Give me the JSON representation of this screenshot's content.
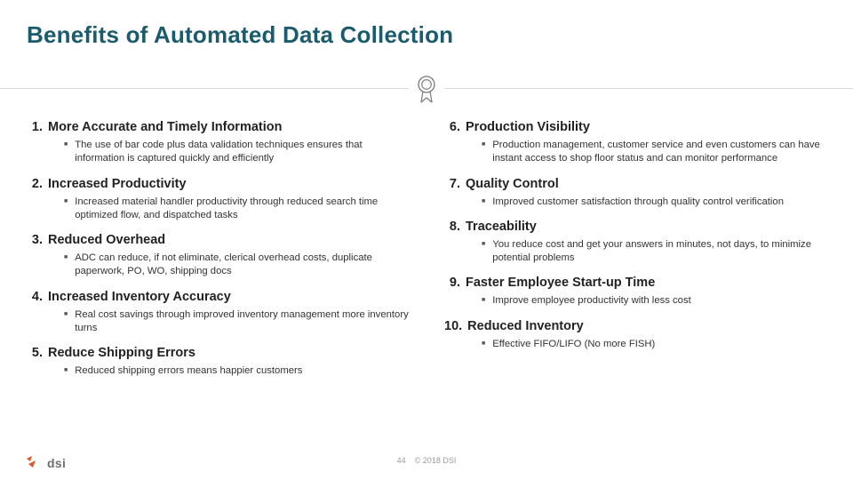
{
  "title": "Benefits of Automated Data Collection",
  "iconName": "award-ribbon-icon",
  "left": [
    {
      "num": "1.",
      "heading": "More Accurate and Timely Information",
      "sub": "The use of bar code plus data validation techniques ensures that information is captured quickly and efficiently"
    },
    {
      "num": "2.",
      "heading": "Increased Productivity",
      "sub": "Increased material handler productivity through reduced search time optimized flow, and dispatched tasks"
    },
    {
      "num": "3.",
      "heading": "Reduced Overhead",
      "sub": "ADC can reduce, if not eliminate, clerical overhead costs, duplicate paperwork, PO, WO, shipping docs"
    },
    {
      "num": "4.",
      "heading": "Increased Inventory Accuracy",
      "sub": "Real cost savings through improved inventory management more inventory turns"
    },
    {
      "num": "5.",
      "heading": "Reduce Shipping Errors",
      "sub": "Reduced shipping errors means happier customers"
    }
  ],
  "right": [
    {
      "num": "6.",
      "heading": "Production Visibility",
      "sub": "Production management, customer service and even customers can have instant access to shop floor status and can monitor performance"
    },
    {
      "num": "7.",
      "heading": "Quality Control",
      "sub": "Improved customer satisfaction through quality control verification"
    },
    {
      "num": "8.",
      "heading": "Traceability",
      "sub": "You reduce cost and get your answers in minutes, not days, to minimize potential problems"
    },
    {
      "num": "9.",
      "heading": "Faster Employee Start-up Time",
      "sub": "Improve employee productivity with less cost"
    },
    {
      "num": "10.",
      "heading": "Reduced Inventory",
      "sub": "Effective FIFO/LIFO (No more FISH)"
    }
  ],
  "footer": {
    "logoText": "dsi",
    "pageNum": "44",
    "copyright": "© 2018 DSI"
  }
}
